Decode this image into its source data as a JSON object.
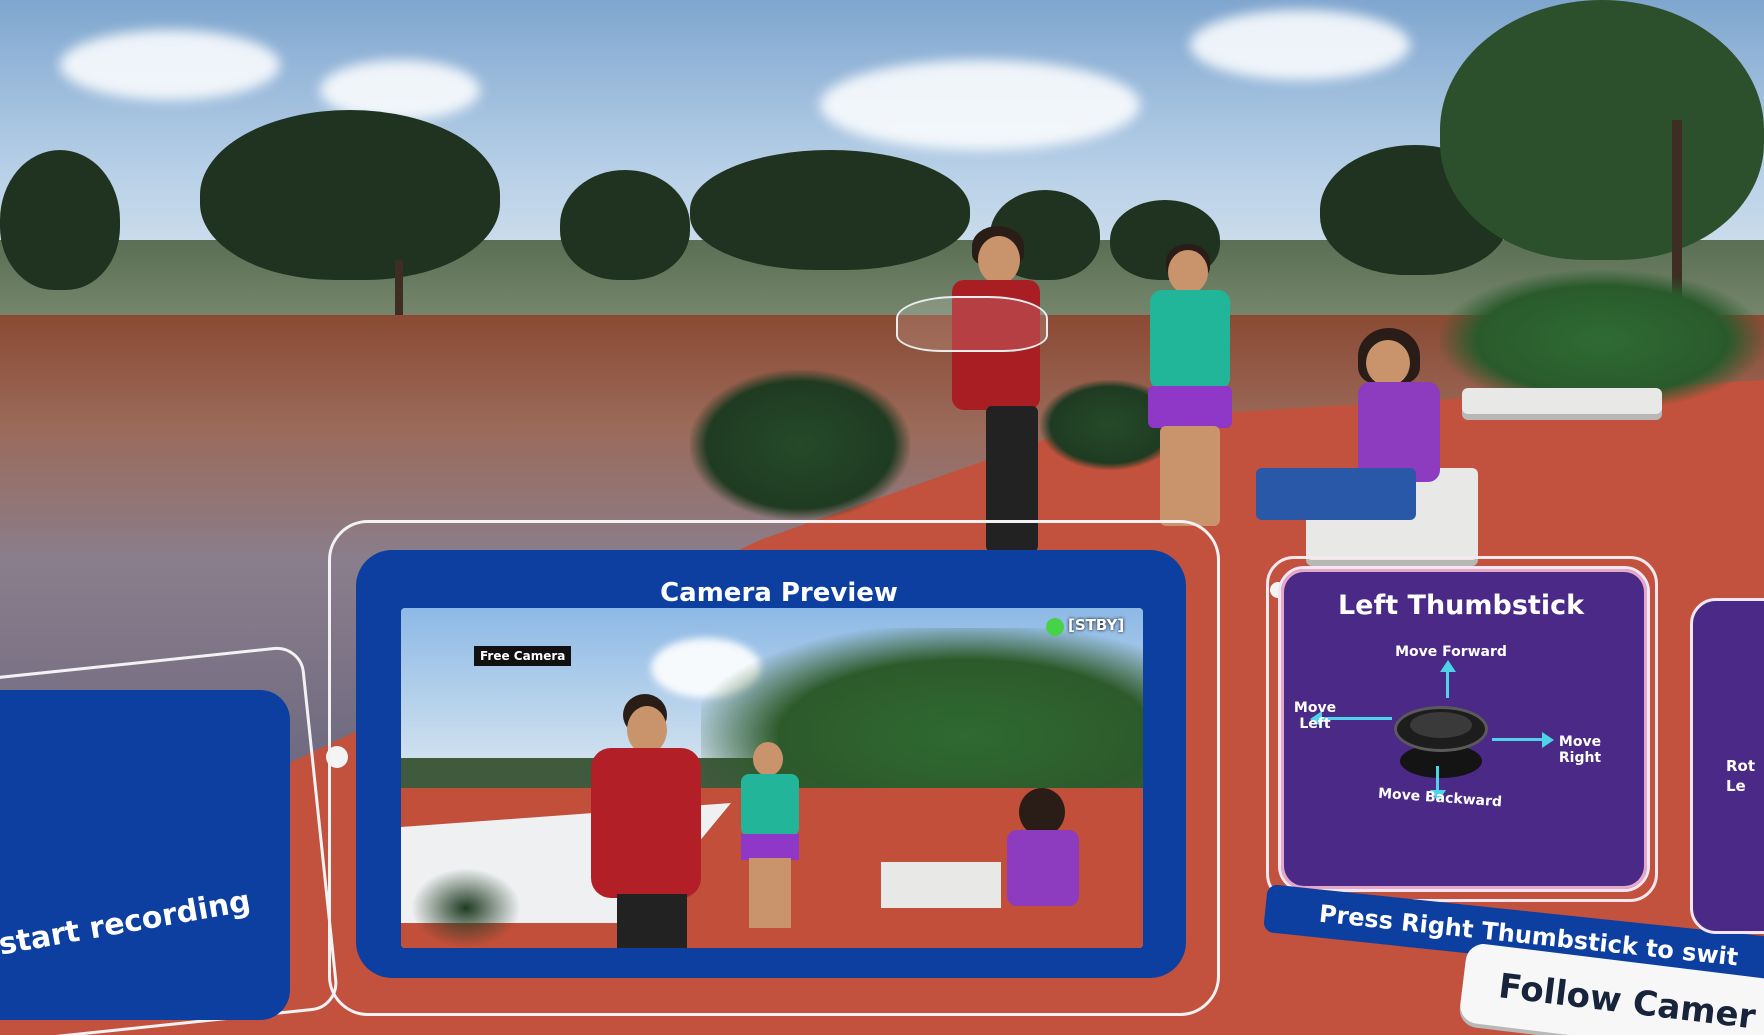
{
  "camera_preview": {
    "title": "Camera Preview",
    "mode_badge": "Free Camera",
    "status": "[STBY]",
    "status_color": "#48d24a"
  },
  "recording_panel": {
    "text": "start recording"
  },
  "left_thumbstick": {
    "title": "Left Thumbstick",
    "move_forward": "Move Forward",
    "move_left": "Move\nLeft",
    "move_right": "Move\nRight",
    "move_backward": "Move Backward",
    "arrow_color": "#4fd3e8"
  },
  "hint_bar": {
    "text": "Press Right Thumbstick to swit"
  },
  "follow_camera_button": {
    "label": "Follow Camer"
  },
  "right_panel": {
    "text": "Rot\nLe"
  },
  "colors": {
    "panel_blue": "#0c3fa0",
    "panel_purple": "#4a2a86",
    "ground": "#c2523d"
  }
}
